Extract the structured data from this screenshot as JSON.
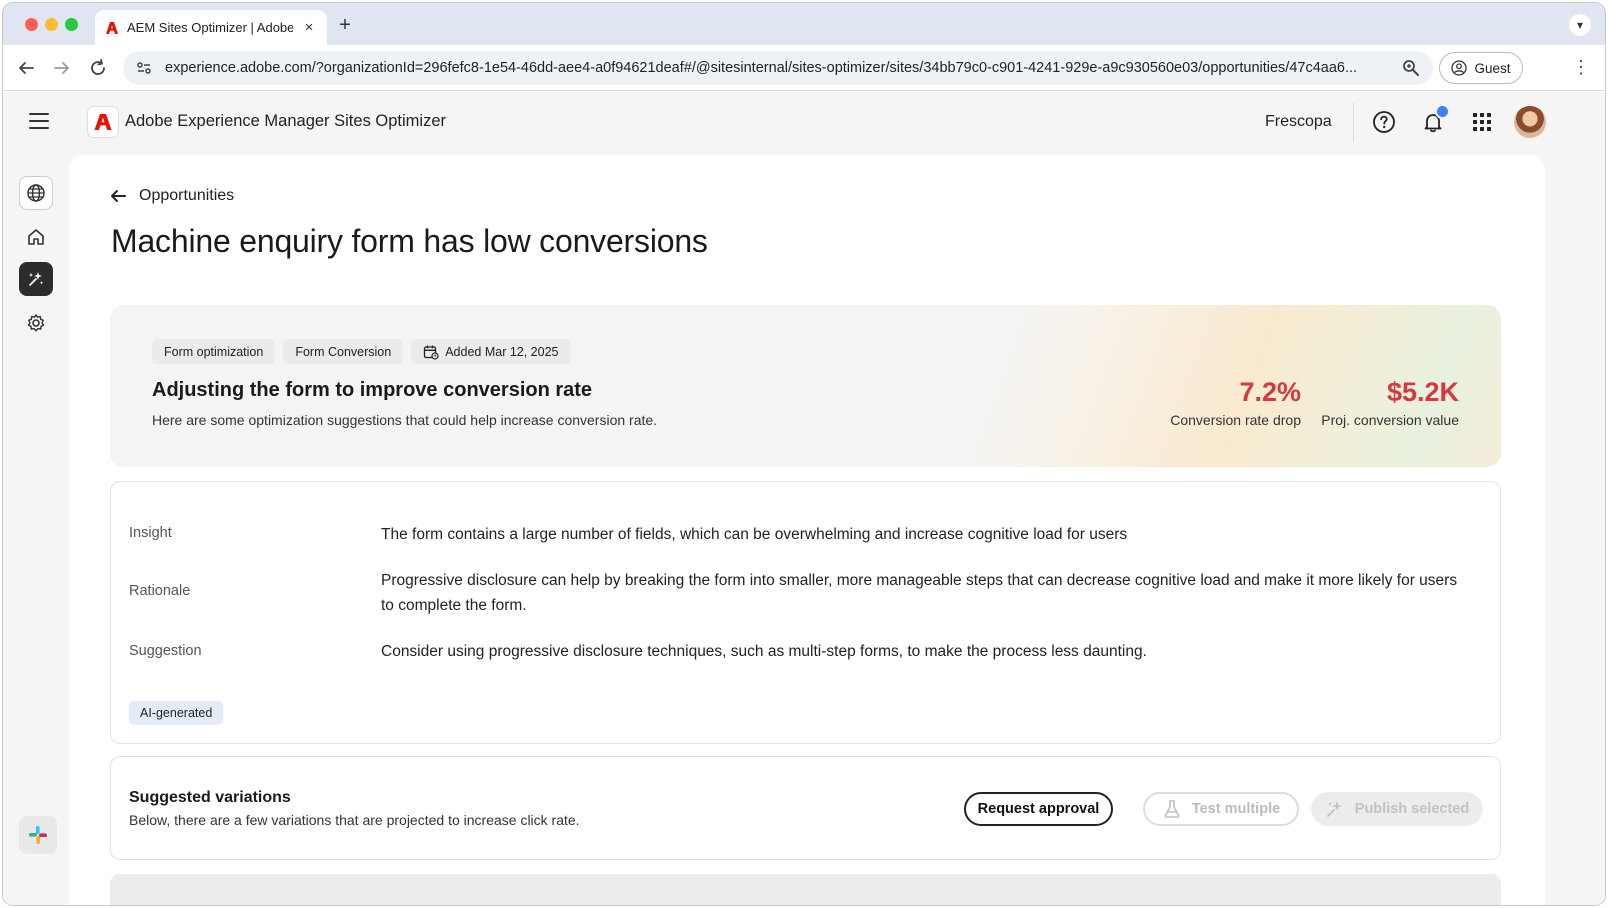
{
  "browser": {
    "tab_title": "AEM Sites Optimizer | Adobe",
    "tab_close": "×",
    "new_tab": "+",
    "url": "experience.adobe.com/?organizationId=296fefc8-1e54-46dd-aee4-a0f94621deaf#/@sitesinternal/sites-optimizer/sites/34bb79c0-c901-4241-929e-a9c930560e03/opportunities/47c4aa6...",
    "profile_label": "Guest"
  },
  "header": {
    "app_name": "Adobe Experience Manager Sites Optimizer",
    "org_name": "Frescopa",
    "accent_color": "#eb1000",
    "notification_dot_color": "#3b82f6"
  },
  "sidebar": {
    "items": [
      {
        "icon": "globe-icon"
      },
      {
        "icon": "home-icon"
      },
      {
        "icon": "opportunities-icon",
        "selected": true
      },
      {
        "icon": "gear-icon"
      }
    ],
    "footer_icon": "slack-icon"
  },
  "main": {
    "back_label": "Opportunities",
    "title": "Machine enquiry form has low conversions",
    "hero": {
      "tags": [
        "Form optimization",
        "Form Conversion"
      ],
      "added_label": "Added Mar 12, 2025",
      "heading": "Adjusting the form to improve conversion rate",
      "description": "Here are some optimization suggestions that could help increase conversion rate.",
      "metrics": [
        {
          "value": "7.2%",
          "label": "Conversion rate drop"
        },
        {
          "value": "$5.2K",
          "label": "Proj. conversion value"
        }
      ],
      "metric_color": "#d7373f"
    },
    "details": {
      "insight_label": "Insight",
      "insight_text": "The form contains a large number of fields, which can be overwhelming and increase cognitive load for users",
      "rationale_label": "Rationale",
      "rationale_text": "Progressive disclosure can help by breaking the form into smaller, more manageable steps that can decrease cognitive load and make it more likely for users to complete the form.",
      "suggestion_label": "Suggestion",
      "suggestion_text": "Consider using progressive disclosure techniques, such as multi-step forms, to make the process less daunting.",
      "ai_badge": "AI-generated"
    },
    "variations": {
      "title": "Suggested variations",
      "description": "Below, there are a few variations that are projected to increase click rate.",
      "request_label": "Request approval",
      "test_label": "Test multiple",
      "publish_label": "Publish selected"
    }
  }
}
